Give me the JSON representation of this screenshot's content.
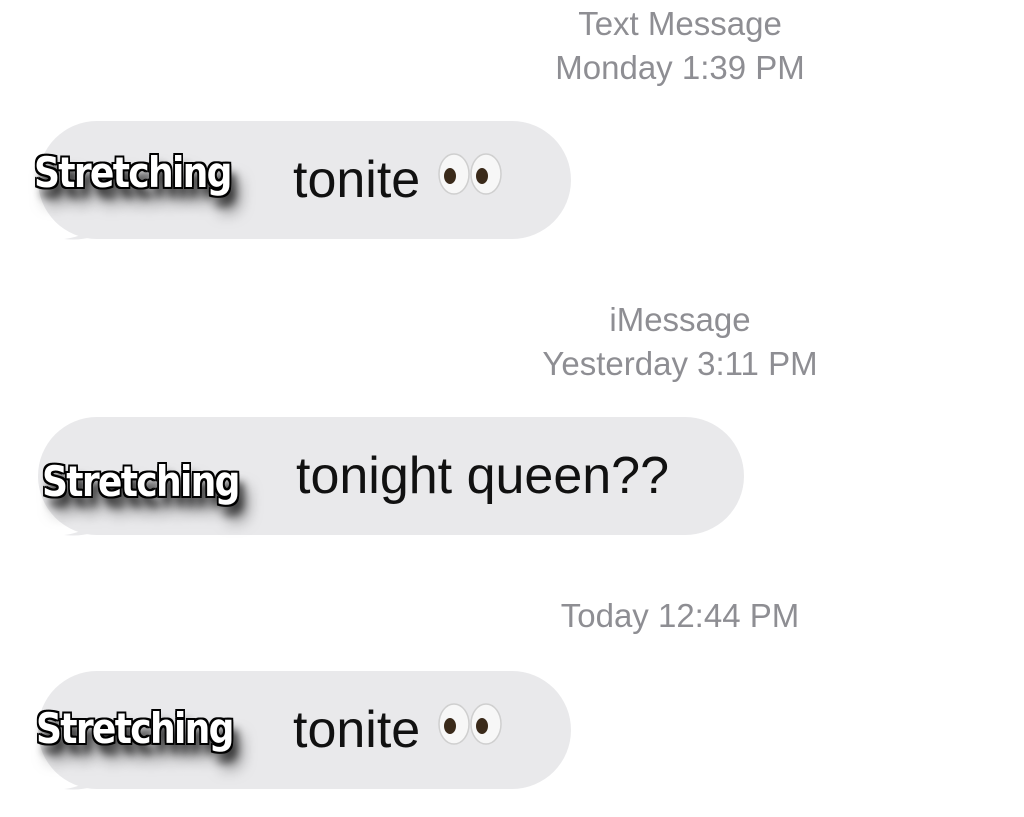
{
  "thread": [
    {
      "meta_lines": [
        "Text Message",
        "Monday 1:39 PM"
      ],
      "overlay": "Stretching",
      "message_text": "tonite",
      "emoji": "eyes-icon"
    },
    {
      "meta_lines": [
        "iMessage",
        "Yesterday 3:11 PM"
      ],
      "overlay": "Stretching",
      "message_text": "tonight queen??",
      "emoji": null
    },
    {
      "meta_lines": [
        "Today 12:44 PM"
      ],
      "overlay": "Stretching",
      "message_text": "tonite",
      "emoji": "eyes-icon"
    }
  ],
  "colors": {
    "bubble_received": "#e9e9eb",
    "meta_text": "#8e8e93",
    "message_text": "#111111",
    "overlay_text": "#ffffff",
    "overlay_outline": "#000000"
  }
}
